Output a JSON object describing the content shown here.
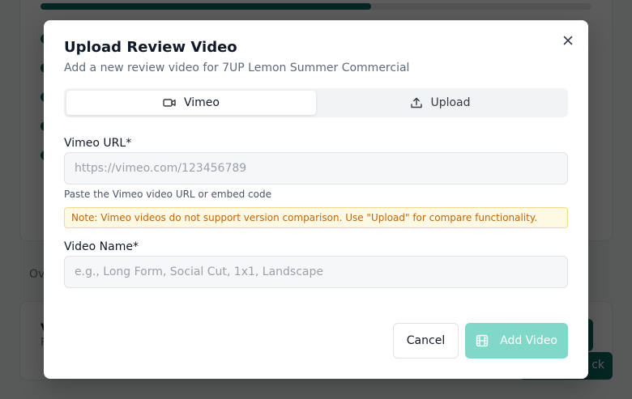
{
  "background": {
    "section_text": "Ov",
    "card_title": "V",
    "card_sub": "F",
    "back_button": "ck",
    "progress_fraction": 0.6
  },
  "modal": {
    "title": "Upload Review Video",
    "description": "Add a new review video for 7UP Lemon Summer Commercial",
    "close_icon": "x-icon",
    "tabs": [
      {
        "label": "Vimeo",
        "icon": "video-camera-icon",
        "active": true
      },
      {
        "label": "Upload",
        "icon": "upload-icon",
        "active": false
      }
    ],
    "vimeo_url": {
      "label": "Vimeo URL*",
      "placeholder": "https://vimeo.com/123456789",
      "value": "",
      "hint": "Paste the Vimeo video URL or embed code"
    },
    "note": "Note: Vimeo videos do not support version comparison. Use \"Upload\" for compare functionality.",
    "video_name": {
      "label": "Video Name*",
      "placeholder": "e.g., Long Form, Social Cut, 1x1, Landscape",
      "value": ""
    },
    "buttons": {
      "cancel": "Cancel",
      "add": "Add Video",
      "add_icon": "film-icon"
    }
  },
  "colors": {
    "brand_dark": "#0f6b63",
    "add_button_disabled": "#7fd8c8",
    "note_text": "#c2650a",
    "note_bg": "#fdf9e3"
  }
}
